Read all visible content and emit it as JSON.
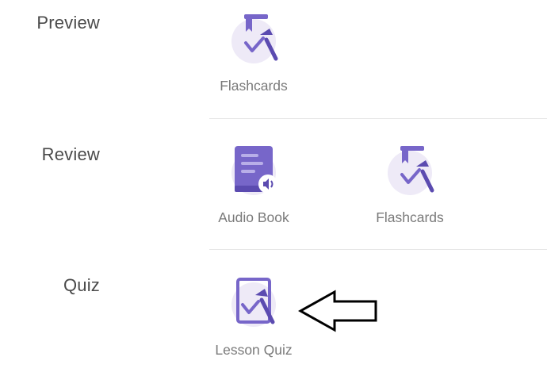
{
  "sections": {
    "preview": {
      "title": "Preview",
      "items": [
        {
          "label": "Flashcards",
          "icon": "flashcards-icon"
        }
      ]
    },
    "review": {
      "title": "Review",
      "items": [
        {
          "label": "Audio Book",
          "icon": "audio-book-icon"
        },
        {
          "label": "Flashcards",
          "icon": "flashcards-icon"
        }
      ]
    },
    "quiz": {
      "title": "Quiz",
      "items": [
        {
          "label": "Lesson Quiz",
          "icon": "lesson-quiz-icon"
        }
      ]
    }
  },
  "colors": {
    "title_text": "#4a4a4a",
    "label_text": "#7a7a7a",
    "icon_purple": "#7766c9",
    "icon_purple_dark": "#5b4bb0",
    "icon_bg": "#eeeaf7",
    "divider": "#e6e6e6"
  },
  "annotation": {
    "icon": "arrow-left-icon"
  }
}
